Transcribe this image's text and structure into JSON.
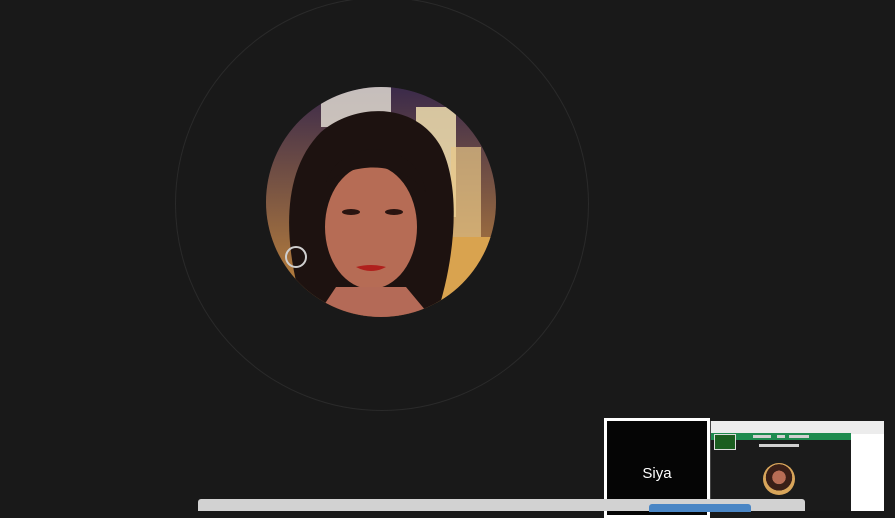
{
  "call": {
    "participant_avatar": "participant-photo",
    "self_tile_name": "Siya"
  },
  "colors": {
    "background": "#191919",
    "tile_border": "#ffffff",
    "bottom_button": "#4a86c5",
    "share_accent": "#1e8b4f"
  }
}
